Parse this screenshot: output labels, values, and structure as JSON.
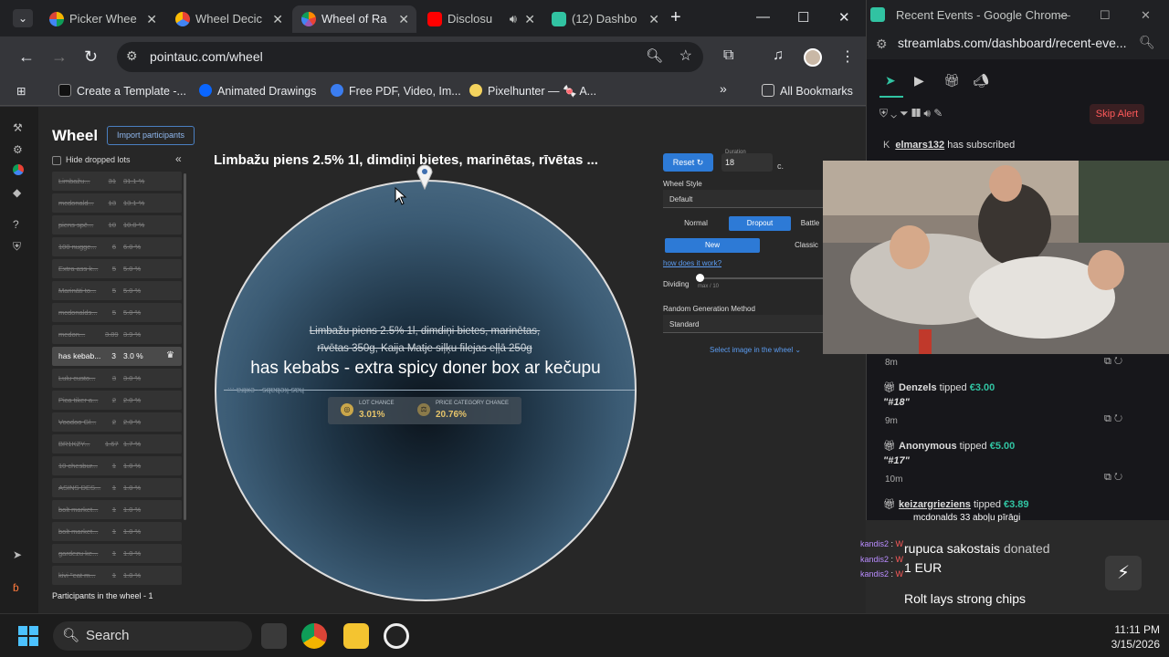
{
  "browser": {
    "tabs": [
      {
        "label": "Picker Whee",
        "color": "#f4b400"
      },
      {
        "label": "Wheel Decic",
        "color": "#e94235"
      },
      {
        "label": "Wheel of Ra",
        "color": "#ff8a00"
      },
      {
        "label": "Disclosu",
        "color": "#ff0000"
      },
      {
        "label": "(12) Dashbo",
        "color": "#31c3a2"
      }
    ],
    "url": "pointauc.com/wheel",
    "bookmarks": [
      "Create a Template -...",
      "Animated Drawings",
      "Free PDF, Video, Im...",
      "Pixelhunter — 🍬 A..."
    ],
    "all_bookmarks": "All Bookmarks"
  },
  "page": {
    "title": "Wheel",
    "import_button": "Import participants",
    "hide_dropped": "Hide dropped lots",
    "participants_count": "Participants in the wheel - 1",
    "lots": [
      {
        "name": "Limbažu...",
        "amount": "31",
        "percent": "31.1 %"
      },
      {
        "name": "mcdonald...",
        "amount": "13",
        "percent": "13.1 %"
      },
      {
        "name": "piens spē...",
        "amount": "10",
        "percent": "10.0 %"
      },
      {
        "name": "100 nugge...",
        "amount": "6",
        "percent": "6.0 %"
      },
      {
        "name": "Extra ass k...",
        "amount": "5",
        "percent": "5.0 %"
      },
      {
        "name": "Marināti to...",
        "amount": "5",
        "percent": "5.0 %"
      },
      {
        "name": "mcdonalds...",
        "amount": "5",
        "percent": "5.0 %"
      },
      {
        "name": "medon...",
        "amount": "3.89",
        "percent": "3.9 %"
      },
      {
        "name": "has kebab...",
        "amount": "3",
        "percent": "3.0 %",
        "active": true
      },
      {
        "name": "Lulu custo...",
        "amount": "3",
        "percent": "3.0 %"
      },
      {
        "name": "Pica tiker a...",
        "amount": "2",
        "percent": "2.0 %"
      },
      {
        "name": "Voodoo Gl...",
        "amount": "2",
        "percent": "2.0 %"
      },
      {
        "name": "BR1KZY...",
        "amount": "1.67",
        "percent": "1.7 %"
      },
      {
        "name": "10 chesbur...",
        "amount": "1",
        "percent": "1.0 %"
      },
      {
        "name": "ASINS DES...",
        "amount": "1",
        "percent": "1.0 %"
      },
      {
        "name": "bolt market...",
        "amount": "1",
        "percent": "1.0 %"
      },
      {
        "name": "bolt market...",
        "amount": "1",
        "percent": "1.0 %"
      },
      {
        "name": "gardezu ke...",
        "amount": "1",
        "percent": "1.0 %"
      },
      {
        "name": "kivi \"eat m...",
        "amount": "1",
        "percent": "1.0 %"
      }
    ],
    "winner_header": "Limbažu piens 2.5% 1l, dimdiņi bietes, marinētas, rīvētas ...",
    "wheel_strike_line1": "Limbažu piens 2.5% 1l, dimdiņi bietes, marinētas,",
    "wheel_strike_line2": "rīvētas 350g, Kaija Matje siļķu filejas eļļā 250g",
    "wheel_current": "has kebabs - extra spicy doner box ar kečupu",
    "wheel_mirror": "has kebabs - extra ...",
    "lot_chance_label": "LOT CHANCE",
    "lot_chance_value": "3.01%",
    "price_chance_label": "PRICE CATEGORY CHANCE",
    "price_chance_value": "20.76%",
    "settings": {
      "reset": "Reset",
      "duration_label": "Duration",
      "duration": "18",
      "duration_unit": "c.",
      "wheel_style_label": "Wheel Style",
      "wheel_style": "Default",
      "modes": [
        "Normal",
        "Dropout",
        "Battle"
      ],
      "active_mode": "Dropout",
      "variants": [
        "New",
        "Classic"
      ],
      "how": "how does it work?",
      "dividing_label": "Dividing",
      "dividing_max": "max / 10",
      "dividing_value": 0,
      "random_label": "Random Generation Method",
      "random_value": "Standard",
      "select_image": "Select image in the wheel"
    }
  },
  "taskbar": {
    "search": "Search",
    "time": "11:11 PM",
    "date": "3/15/2026"
  },
  "side": {
    "title": "Recent Events - Google Chrome",
    "url": "streamlabs.com/dashboard/recent-eve...",
    "skip_alert": "Skip Alert",
    "events": [
      {
        "user": "elmars132",
        "action": "has subscribed"
      },
      {
        "time": "8m"
      },
      {
        "user": "Denzels",
        "action": "tipped",
        "amount": "€3.00",
        "message": "\"#18\"",
        "time": "9m"
      },
      {
        "user": "Anonymous",
        "action": "tipped",
        "amount": "€5.00",
        "message": "\"#17\"",
        "time": "10m"
      },
      {
        "user": "keizargrieziens",
        "action": "tipped",
        "amount": "€3.89"
      }
    ]
  },
  "chat": {
    "top_line": "mcdonalds 33 aboļu pīrāgi",
    "lines": [
      {
        "user": "kandis2",
        "text": "W",
        "color": "#b98cff"
      },
      {
        "user": "kandis2",
        "text": "W",
        "color": "#b98cff"
      },
      {
        "user": "kandis2",
        "text": "W",
        "color": "#b98cff"
      }
    ],
    "donor": "rupuca sakostais",
    "donated": "donated",
    "amount": "1 EUR",
    "message": "Rolt lays strong chips"
  }
}
